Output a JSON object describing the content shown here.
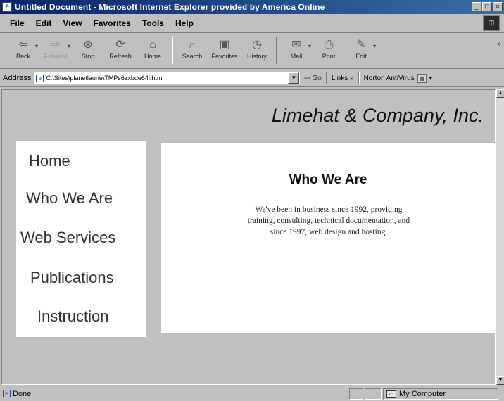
{
  "window": {
    "title": "Untitled Document - Microsoft Internet Explorer provided by America Online"
  },
  "menu": [
    "File",
    "Edit",
    "View",
    "Favorites",
    "Tools",
    "Help"
  ],
  "toolbar": {
    "buttons": [
      {
        "label": "Back",
        "icon": "back-arrow-icon",
        "glyph": "⇦",
        "dropdown": true,
        "disabled": false
      },
      {
        "label": "Forward",
        "icon": "forward-arrow-icon",
        "glyph": "⇨",
        "dropdown": true,
        "disabled": true
      },
      {
        "label": "Stop",
        "icon": "stop-icon",
        "glyph": "⊗",
        "dropdown": false,
        "disabled": false
      },
      {
        "label": "Refresh",
        "icon": "refresh-icon",
        "glyph": "⟳",
        "dropdown": false,
        "disabled": false
      },
      {
        "label": "Home",
        "icon": "home-icon",
        "glyph": "⌂",
        "dropdown": false,
        "disabled": false
      },
      {
        "label": "Search",
        "icon": "search-icon",
        "glyph": "⌕",
        "dropdown": false,
        "disabled": false
      },
      {
        "label": "Favorites",
        "icon": "favorites-icon",
        "glyph": "▣",
        "dropdown": false,
        "disabled": false
      },
      {
        "label": "History",
        "icon": "history-icon",
        "glyph": "◷",
        "dropdown": false,
        "disabled": false
      },
      {
        "label": "Mail",
        "icon": "mail-icon",
        "glyph": "✉",
        "dropdown": true,
        "disabled": false
      },
      {
        "label": "Print",
        "icon": "print-icon",
        "glyph": "⎙",
        "dropdown": false,
        "disabled": false
      },
      {
        "label": "Edit",
        "icon": "edit-icon",
        "glyph": "✎",
        "dropdown": true,
        "disabled": false
      }
    ]
  },
  "address": {
    "label": "Address",
    "value": "C:\\Sites\\planetlaurie\\TMPs6zxbde64i.htm",
    "go_label": "Go",
    "links_label": "Links »",
    "norton_label": "Norton AntiVirus"
  },
  "page": {
    "site_title": "Limehat & Company, Inc.",
    "nav": [
      "Home",
      "Who We Are",
      "Web Services",
      "Publications",
      "Instruction"
    ],
    "heading": "Who We Are",
    "body": "We've been in business since 1992, providing training, consulting, technical documentation, and since 1997, web design and hosting."
  },
  "status": {
    "text": "Done",
    "zone": "My Computer"
  }
}
